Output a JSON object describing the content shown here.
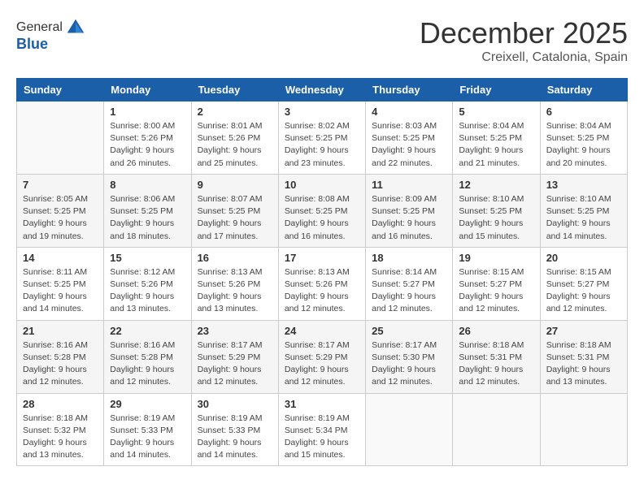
{
  "logo": {
    "general": "General",
    "blue": "Blue"
  },
  "header": {
    "month": "December 2025",
    "location": "Creixell, Catalonia, Spain"
  },
  "weekdays": [
    "Sunday",
    "Monday",
    "Tuesday",
    "Wednesday",
    "Thursday",
    "Friday",
    "Saturday"
  ],
  "weeks": [
    [
      {
        "day": "",
        "info": ""
      },
      {
        "day": "1",
        "info": "Sunrise: 8:00 AM\nSunset: 5:26 PM\nDaylight: 9 hours\nand 26 minutes."
      },
      {
        "day": "2",
        "info": "Sunrise: 8:01 AM\nSunset: 5:26 PM\nDaylight: 9 hours\nand 25 minutes."
      },
      {
        "day": "3",
        "info": "Sunrise: 8:02 AM\nSunset: 5:25 PM\nDaylight: 9 hours\nand 23 minutes."
      },
      {
        "day": "4",
        "info": "Sunrise: 8:03 AM\nSunset: 5:25 PM\nDaylight: 9 hours\nand 22 minutes."
      },
      {
        "day": "5",
        "info": "Sunrise: 8:04 AM\nSunset: 5:25 PM\nDaylight: 9 hours\nand 21 minutes."
      },
      {
        "day": "6",
        "info": "Sunrise: 8:04 AM\nSunset: 5:25 PM\nDaylight: 9 hours\nand 20 minutes."
      }
    ],
    [
      {
        "day": "7",
        "info": "Sunrise: 8:05 AM\nSunset: 5:25 PM\nDaylight: 9 hours\nand 19 minutes."
      },
      {
        "day": "8",
        "info": "Sunrise: 8:06 AM\nSunset: 5:25 PM\nDaylight: 9 hours\nand 18 minutes."
      },
      {
        "day": "9",
        "info": "Sunrise: 8:07 AM\nSunset: 5:25 PM\nDaylight: 9 hours\nand 17 minutes."
      },
      {
        "day": "10",
        "info": "Sunrise: 8:08 AM\nSunset: 5:25 PM\nDaylight: 9 hours\nand 16 minutes."
      },
      {
        "day": "11",
        "info": "Sunrise: 8:09 AM\nSunset: 5:25 PM\nDaylight: 9 hours\nand 16 minutes."
      },
      {
        "day": "12",
        "info": "Sunrise: 8:10 AM\nSunset: 5:25 PM\nDaylight: 9 hours\nand 15 minutes."
      },
      {
        "day": "13",
        "info": "Sunrise: 8:10 AM\nSunset: 5:25 PM\nDaylight: 9 hours\nand 14 minutes."
      }
    ],
    [
      {
        "day": "14",
        "info": "Sunrise: 8:11 AM\nSunset: 5:25 PM\nDaylight: 9 hours\nand 14 minutes."
      },
      {
        "day": "15",
        "info": "Sunrise: 8:12 AM\nSunset: 5:26 PM\nDaylight: 9 hours\nand 13 minutes."
      },
      {
        "day": "16",
        "info": "Sunrise: 8:13 AM\nSunset: 5:26 PM\nDaylight: 9 hours\nand 13 minutes."
      },
      {
        "day": "17",
        "info": "Sunrise: 8:13 AM\nSunset: 5:26 PM\nDaylight: 9 hours\nand 12 minutes."
      },
      {
        "day": "18",
        "info": "Sunrise: 8:14 AM\nSunset: 5:27 PM\nDaylight: 9 hours\nand 12 minutes."
      },
      {
        "day": "19",
        "info": "Sunrise: 8:15 AM\nSunset: 5:27 PM\nDaylight: 9 hours\nand 12 minutes."
      },
      {
        "day": "20",
        "info": "Sunrise: 8:15 AM\nSunset: 5:27 PM\nDaylight: 9 hours\nand 12 minutes."
      }
    ],
    [
      {
        "day": "21",
        "info": "Sunrise: 8:16 AM\nSunset: 5:28 PM\nDaylight: 9 hours\nand 12 minutes."
      },
      {
        "day": "22",
        "info": "Sunrise: 8:16 AM\nSunset: 5:28 PM\nDaylight: 9 hours\nand 12 minutes."
      },
      {
        "day": "23",
        "info": "Sunrise: 8:17 AM\nSunset: 5:29 PM\nDaylight: 9 hours\nand 12 minutes."
      },
      {
        "day": "24",
        "info": "Sunrise: 8:17 AM\nSunset: 5:29 PM\nDaylight: 9 hours\nand 12 minutes."
      },
      {
        "day": "25",
        "info": "Sunrise: 8:17 AM\nSunset: 5:30 PM\nDaylight: 9 hours\nand 12 minutes."
      },
      {
        "day": "26",
        "info": "Sunrise: 8:18 AM\nSunset: 5:31 PM\nDaylight: 9 hours\nand 12 minutes."
      },
      {
        "day": "27",
        "info": "Sunrise: 8:18 AM\nSunset: 5:31 PM\nDaylight: 9 hours\nand 13 minutes."
      }
    ],
    [
      {
        "day": "28",
        "info": "Sunrise: 8:18 AM\nSunset: 5:32 PM\nDaylight: 9 hours\nand 13 minutes."
      },
      {
        "day": "29",
        "info": "Sunrise: 8:19 AM\nSunset: 5:33 PM\nDaylight: 9 hours\nand 14 minutes."
      },
      {
        "day": "30",
        "info": "Sunrise: 8:19 AM\nSunset: 5:33 PM\nDaylight: 9 hours\nand 14 minutes."
      },
      {
        "day": "31",
        "info": "Sunrise: 8:19 AM\nSunset: 5:34 PM\nDaylight: 9 hours\nand 15 minutes."
      },
      {
        "day": "",
        "info": ""
      },
      {
        "day": "",
        "info": ""
      },
      {
        "day": "",
        "info": ""
      }
    ]
  ]
}
